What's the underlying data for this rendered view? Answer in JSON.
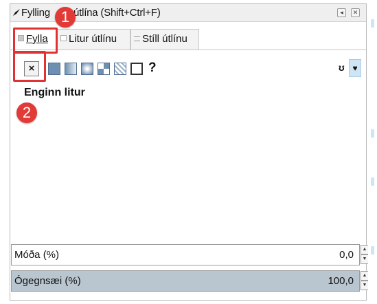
{
  "dialog": {
    "title": "Fylling og útlína (Shift+Ctrl+F)",
    "title_visible": "Fylling",
    "title_rest": "útlína (Shift+Ctrl+F)"
  },
  "tabs": [
    {
      "label": "Fylla",
      "active": true
    },
    {
      "label": "Litur útlínu",
      "active": false
    },
    {
      "label": "Stíll útlínu",
      "active": false
    }
  ],
  "paint_buttons": [
    {
      "name": "no-paint",
      "glyph": "×"
    },
    {
      "name": "flat-color"
    },
    {
      "name": "linear-gradient"
    },
    {
      "name": "radial-gradient"
    },
    {
      "name": "mesh-gradient"
    },
    {
      "name": "pattern"
    },
    {
      "name": "swatch"
    },
    {
      "name": "unset",
      "glyph": "?"
    }
  ],
  "fill_rule": {
    "evenodd_glyph": "ʊ",
    "nonzero_glyph": "♥"
  },
  "fill_label": "Enginn litur",
  "blur": {
    "label": "Móða (%)",
    "value": "0,0",
    "fraction": 0
  },
  "opacity": {
    "label": "Ógegnsæi (%)",
    "value": "100,0",
    "fraction": 1
  },
  "callouts": [
    {
      "number": "1"
    },
    {
      "number": "2"
    }
  ],
  "colors": {
    "callout": "#e23a36",
    "slider_fill": "#b9c6cf",
    "accent": "#cfe5f4"
  }
}
